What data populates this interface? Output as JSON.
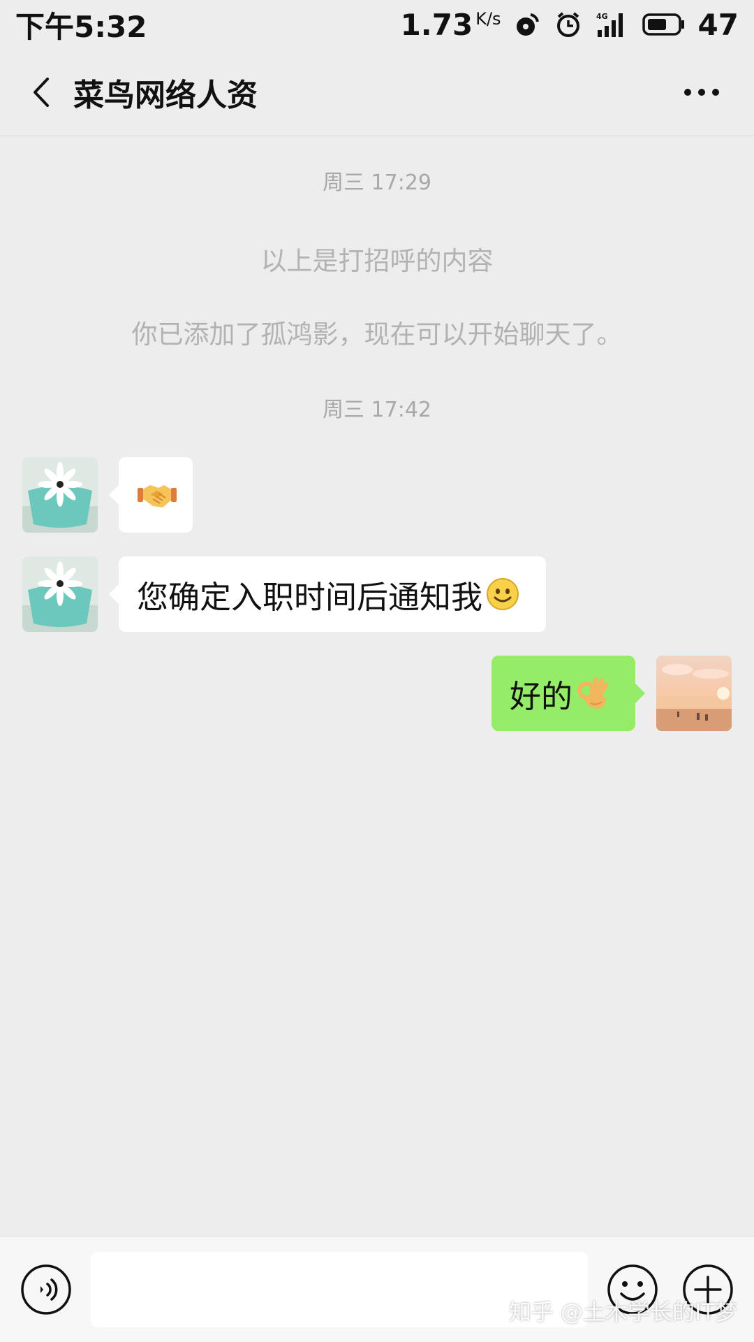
{
  "status_bar": {
    "time": "下午5:32",
    "net_speed": "1.73",
    "net_speed_unit": "K/s",
    "battery_level": "47"
  },
  "header": {
    "title": "菜鸟网络人资"
  },
  "messages": {
    "timestamp_1": "周三 17:29",
    "system_1": "以上是打招呼的内容",
    "system_2": "你已添加了孤鸿影，现在可以开始聊天了。",
    "timestamp_2": "周三 17:42",
    "msg_1_emoji": "handshake-icon",
    "msg_2_text": "您确定入职时间后通知我",
    "msg_2_emoji": "smile-icon",
    "msg_3_text": "好的",
    "msg_3_emoji": "ok-hand-icon"
  },
  "input_bar": {
    "value": ""
  },
  "watermark": "知乎 @土木学长的IT梦",
  "colors": {
    "background": "#ededed",
    "self_bubble": "#95ec69",
    "other_bubble": "#ffffff",
    "timestamp_text": "#a8a8a8"
  }
}
